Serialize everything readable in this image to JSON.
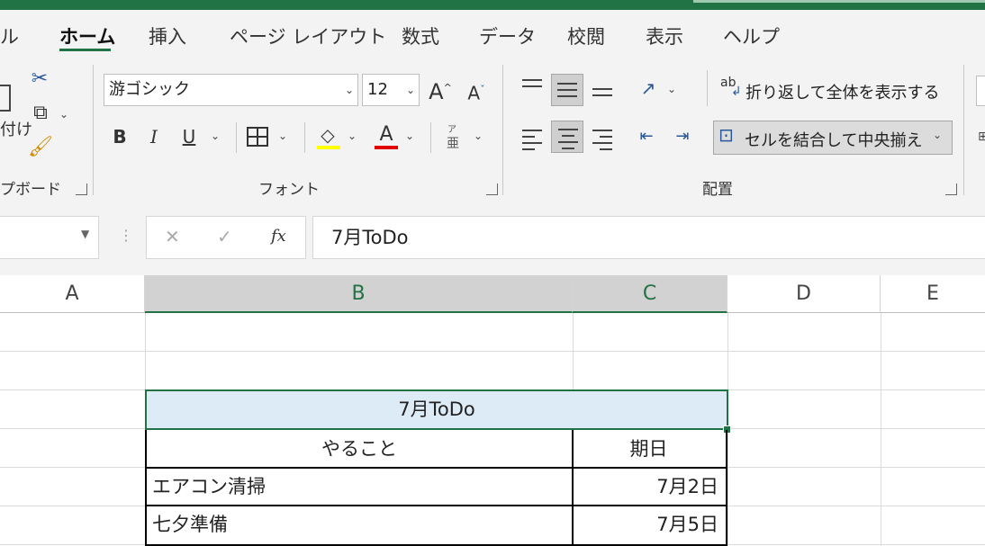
{
  "tabs": [
    {
      "label": "ル"
    },
    {
      "label": "ホーム",
      "active": true
    },
    {
      "label": "挿入"
    },
    {
      "label": "ページ レイアウト"
    },
    {
      "label": "数式"
    },
    {
      "label": "データ"
    },
    {
      "label": "校閲"
    },
    {
      "label": "表示"
    },
    {
      "label": "ヘルプ"
    }
  ],
  "ribbon": {
    "clipboard": {
      "group_label": "プボード",
      "paste_fragment": "付け"
    },
    "font": {
      "group_label": "フォント",
      "font_name": "游ゴシック",
      "font_size": "12",
      "grow_label": "A",
      "shrink_label": "A",
      "bold": "B",
      "italic": "I",
      "underline": "U",
      "font_color_letter": "A",
      "phonetic_top": "ア",
      "phonetic_bottom": "亜"
    },
    "alignment": {
      "group_label": "配置",
      "wrap_text": "折り返して全体を表示する",
      "merge_center": "セルを結合して中央揃え",
      "wrap_icon_text": "ab"
    }
  },
  "formula_bar": {
    "cancel": "✕",
    "enter": "✓",
    "fx": "fx",
    "content": "7月ToDo"
  },
  "columns": [
    "A",
    "B",
    "C",
    "D",
    "E"
  ],
  "sheet": {
    "title": "7月ToDo",
    "headers": {
      "task": "やること",
      "date": "期日"
    },
    "rows": [
      {
        "task": "エアコン清掃",
        "date": "7月2日"
      },
      {
        "task": "七夕準備",
        "date": "7月5日"
      }
    ]
  },
  "colors": {
    "accent": "#217346",
    "selected_fill": "#ddebf7",
    "font_color_bar": "#e00000"
  }
}
